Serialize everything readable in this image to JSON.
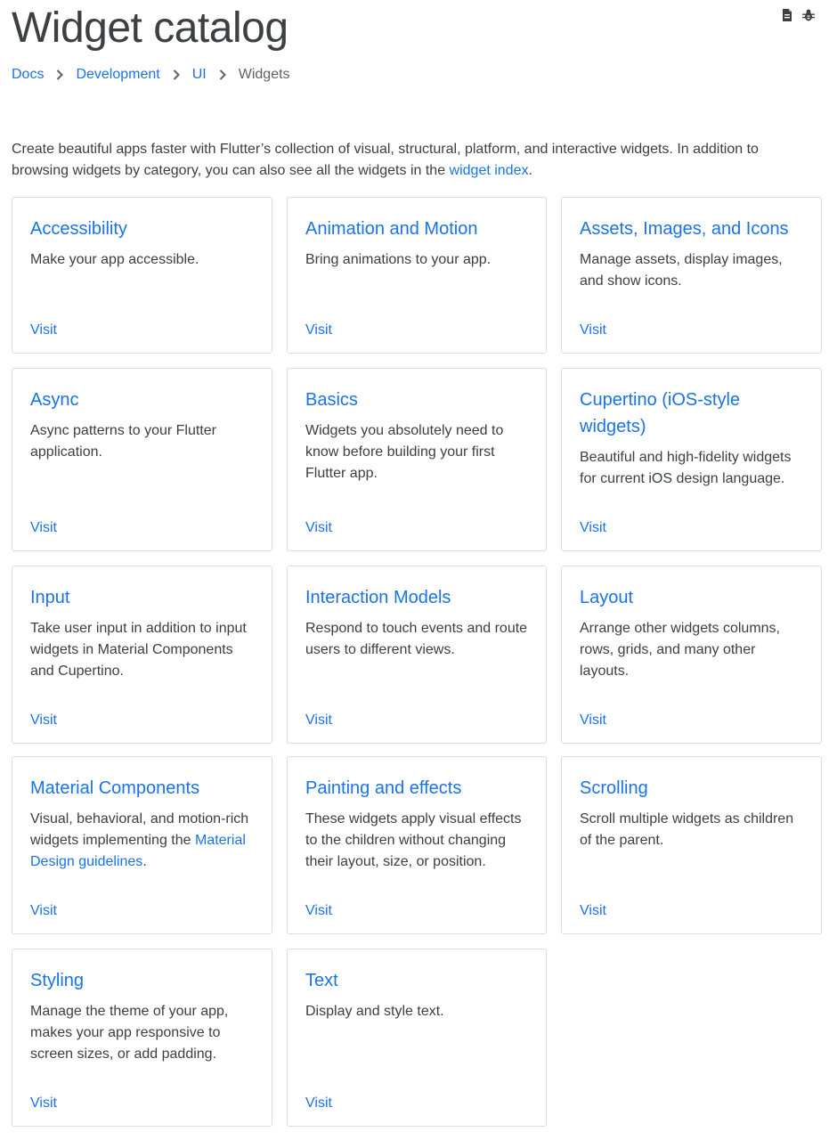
{
  "page": {
    "title": "Widget catalog",
    "tools": [
      {
        "icon": "document-icon"
      },
      {
        "icon": "bug-icon"
      }
    ]
  },
  "breadcrumb": [
    {
      "label": "Docs"
    },
    {
      "label": "Development"
    },
    {
      "label": "UI"
    },
    {
      "label": "Widgets"
    }
  ],
  "intro": {
    "text": "Create beautiful apps faster with Flutter’s collection of visual, structural, platform, and interactive widgets. In addition to browsing widgets by category, you can also see all the widgets in the ",
    "link": "widget index",
    "suffix": "."
  },
  "cards": [
    {
      "title": "Accessibility",
      "desc": "Make your app accessible.",
      "visit": "Visit"
    },
    {
      "title": "Animation and Motion",
      "desc": "Bring animations to your app.",
      "visit": "Visit"
    },
    {
      "title": "Assets, Images, and Icons",
      "desc": "Manage assets, display images, and show icons.",
      "visit": "Visit"
    },
    {
      "title": "Async",
      "desc": "Async patterns to your Flutter application.",
      "visit": "Visit"
    },
    {
      "title": "Basics",
      "desc": "Widgets you absolutely need to know before building your first Flutter app.",
      "visit": "Visit"
    },
    {
      "title": "Cupertino (iOS-style widgets)",
      "desc": "Beautiful and high-fidelity widgets for current iOS design language.",
      "visit": "Visit"
    },
    {
      "title": "Input",
      "desc": "Take user input in addition to input widgets in Material Components and Cupertino.",
      "visit": "Visit"
    },
    {
      "title": "Interaction Models",
      "desc": "Respond to touch events and route users to different views.",
      "visit": "Visit"
    },
    {
      "title": "Layout",
      "desc": "Arrange other widgets columns, rows, grids, and many other layouts.",
      "visit": "Visit"
    },
    {
      "title": "Material Components",
      "desc": "Visual, behavioral, and motion-rich widgets implementing the ",
      "desc_link": "Material Design guidelines",
      "desc_suffix": ".",
      "visit": "Visit"
    },
    {
      "title": "Painting and effects",
      "desc": "These widgets apply visual effects to the children without changing their layout, size, or position.",
      "visit": "Visit"
    },
    {
      "title": "Scrolling",
      "desc": "Scroll multiple widgets as children of the parent.",
      "visit": "Visit"
    },
    {
      "title": "Styling",
      "desc": "Manage the theme of your app, makes your app responsive to screen sizes, or add padding.",
      "visit": "Visit"
    },
    {
      "title": "Text",
      "desc": "Display and style text.",
      "visit": "Visit"
    }
  ]
}
